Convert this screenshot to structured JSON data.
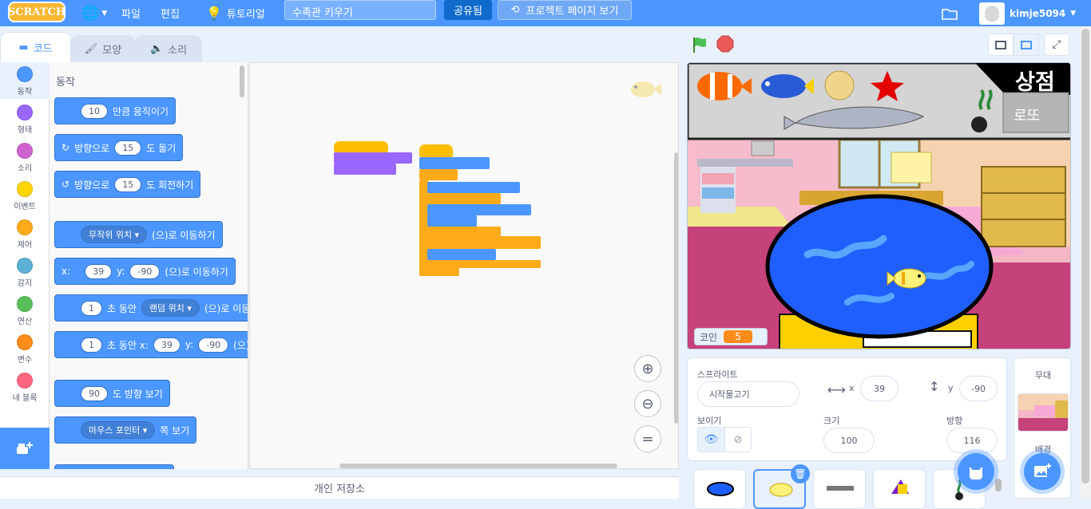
{
  "menubar": {
    "logo": "SCRATCH",
    "file": "파일",
    "edit": "편집",
    "tutorial": "튜토리얼",
    "project_title": "수족관 키우기",
    "share": "공유됨",
    "see_project_page": "프로젝트 페이지 보기",
    "username": "kimje5094"
  },
  "tabs": {
    "code": "코드",
    "costumes": "모양",
    "sounds": "소리"
  },
  "categories": [
    {
      "label": "동작",
      "color": "#4c97ff"
    },
    {
      "label": "형태",
      "color": "#9966ff"
    },
    {
      "label": "소리",
      "color": "#cf63cf"
    },
    {
      "label": "이벤트",
      "color": "#ffd500"
    },
    {
      "label": "제어",
      "color": "#ffab19"
    },
    {
      "label": "감지",
      "color": "#5cb1d6"
    },
    {
      "label": "연산",
      "color": "#59c059"
    },
    {
      "label": "변수",
      "color": "#ff8c1a"
    },
    {
      "label": "내 블록",
      "color": "#ff6680"
    }
  ],
  "palette": {
    "title": "동작",
    "move_steps": "10",
    "move_label": "만큼 움직이기",
    "turn_right_label": "방향으로",
    "turn_right_deg": "15",
    "turn_right_end": "도 돌기",
    "turn_left_label": "방향으로",
    "turn_left_deg": "15",
    "turn_left_end": "도 회전하기",
    "goto_random": "무작위 위치",
    "goto_end": "(으)로 이동하기",
    "goto_xy_x_label": "x:",
    "goto_x": "39",
    "goto_xy_y_label": "y:",
    "goto_y": "-90",
    "goto_xy_end": "(으)로 이동하기",
    "glide_secs": "1",
    "glide_label": "초 동안",
    "glide_target": "랜덤 위치",
    "glide_end": "(으)로 이동",
    "glide2_secs": "1",
    "glide2_label": "초 동안 x:",
    "glide2_x": "39",
    "glide2_y_label": "y:",
    "glide2_y": "-90",
    "glide2_end": "(으)로 이",
    "point_dir": "90",
    "point_end": "도 방향 보기",
    "point_towards": "마우스 포인터",
    "point_towards_end": "쪽 보기"
  },
  "backpack": "개인 저장소",
  "stage": {
    "shop_label": "상점",
    "lotto_label": "로또",
    "coin_label": "코인",
    "coin_value": "5"
  },
  "sprite_info": {
    "sprite_label": "스프라이트",
    "sprite_name": "시작물고기",
    "x_label": "x",
    "x": "39",
    "y_label": "y",
    "y": "-90",
    "show_label": "보이기",
    "size_label": "크기",
    "size": "100",
    "direction_label": "방향",
    "direction": "116"
  },
  "stage_selector": {
    "title": "무대",
    "backdrop_label": "배경"
  },
  "colors": {
    "accent": "#4c97ff",
    "motion": "#4c97ff",
    "events": "#ffbf00",
    "control": "#ffab19",
    "looks": "#9966ff",
    "sensing": "#5cb1d6",
    "operators": "#59c059"
  }
}
